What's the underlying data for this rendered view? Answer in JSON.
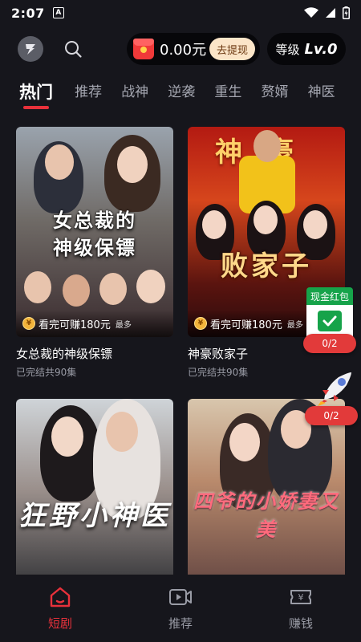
{
  "status_bar": {
    "time": "2:07",
    "notification_badge": "A"
  },
  "header": {
    "balance": "0.00元",
    "withdraw_label": "去提现",
    "level_label": "等级",
    "level_value": "Lv.0"
  },
  "tabs": [
    {
      "label": "热门",
      "active": true
    },
    {
      "label": "推荐"
    },
    {
      "label": "战神"
    },
    {
      "label": "逆袭"
    },
    {
      "label": "重生"
    },
    {
      "label": "赘婿"
    },
    {
      "label": "神医"
    }
  ],
  "cards": [
    {
      "title": "女总裁的神级保镖",
      "meta": "已完结共90集",
      "poster_title_line1": "女总裁的",
      "poster_title_line2": "神级保镖",
      "reward": "看完可赚180元",
      "reward_suffix": "最多"
    },
    {
      "title": "神豪败家子",
      "meta": "已完结共90集",
      "poster_title_top": "神豪",
      "poster_title_main": "败家子",
      "reward": "看完可赚180元",
      "reward_suffix": "最多"
    },
    {
      "poster_title": "狂野小神医"
    },
    {
      "poster_title": "四爷的小娇妻又美"
    }
  ],
  "widgets": {
    "cash_label": "现金红包",
    "cash_progress": "0/2",
    "rocket_progress": "0/2"
  },
  "bottom_nav": [
    {
      "label": "短剧",
      "icon": "home-icon",
      "active": true
    },
    {
      "label": "推荐",
      "icon": "play-icon"
    },
    {
      "label": "赚钱",
      "icon": "ticket-icon"
    }
  ],
  "colors": {
    "accent": "#e8313b",
    "background": "#16161c",
    "cash_green": "#16a34a"
  }
}
